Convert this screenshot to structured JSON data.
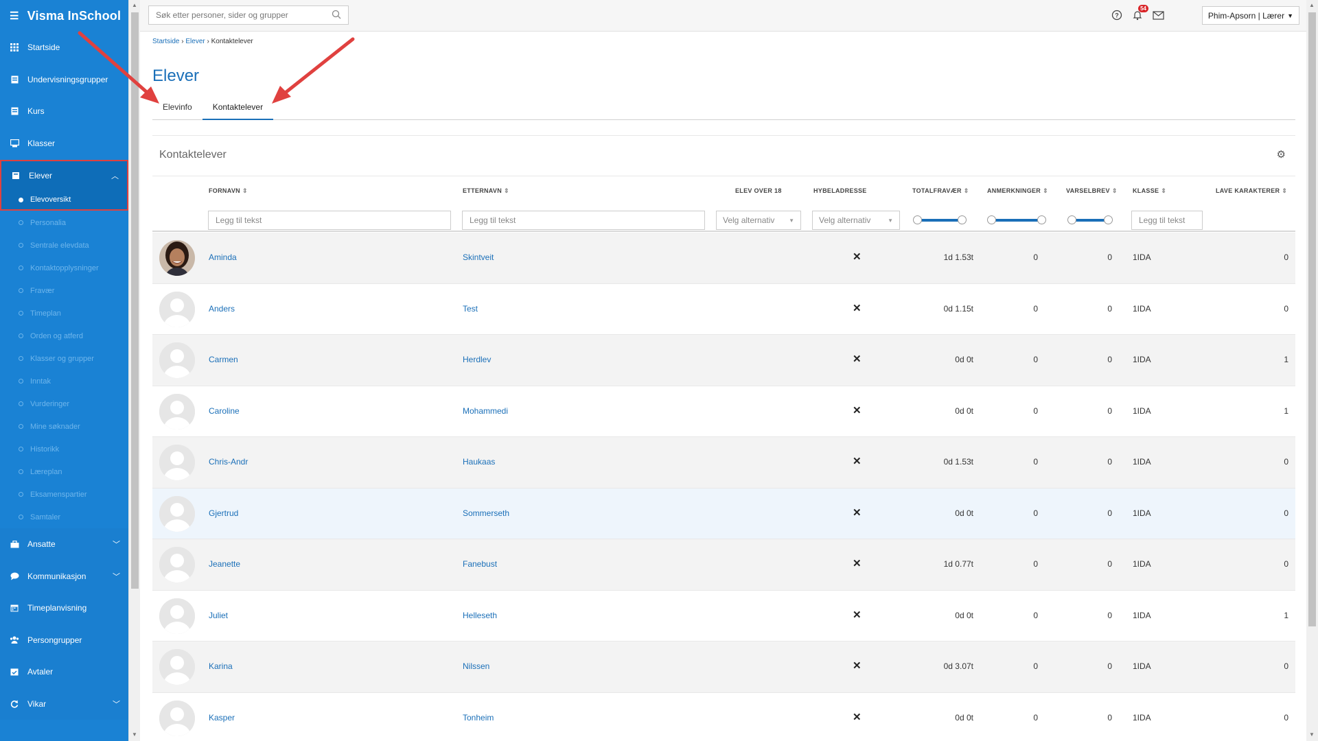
{
  "app": {
    "title": "Visma InSchool"
  },
  "sidebar": {
    "items_top": [
      {
        "label": "Startside",
        "icon": "grid-icon"
      },
      {
        "label": "Undervisningsgrupper",
        "icon": "book-icon"
      },
      {
        "label": "Kurs",
        "icon": "book-icon"
      },
      {
        "label": "Klasser",
        "icon": "board-icon"
      }
    ],
    "elever": {
      "label": "Elever",
      "active_sub": "Elevoversikt"
    },
    "subitems": [
      "Personalia",
      "Sentrale elevdata",
      "Kontaktopplysninger",
      "Fravær",
      "Timeplan",
      "Orden og atferd",
      "Klasser og grupper",
      "Inntak",
      "Vurderinger",
      "Mine søknader",
      "Historikk",
      "Læreplan",
      "Eksamenspartier",
      "Samtaler"
    ],
    "items_bottom": [
      {
        "label": "Ansatte",
        "icon": "briefcase-icon",
        "expandable": true
      },
      {
        "label": "Kommunikasjon",
        "icon": "chat-icon",
        "expandable": true
      },
      {
        "label": "Timeplanvisning",
        "icon": "calendar-icon",
        "expandable": false
      },
      {
        "label": "Persongrupper",
        "icon": "people-icon",
        "expandable": false
      },
      {
        "label": "Avtaler",
        "icon": "calendar-check-icon",
        "expandable": false
      },
      {
        "label": "Vikar",
        "icon": "refresh-icon",
        "expandable": true
      }
    ]
  },
  "topbar": {
    "search_placeholder": "Søk etter personer, sider og grupper",
    "notification_count": "54",
    "user_label": "Phim-Apsorn | Lærer"
  },
  "breadcrumb": {
    "items": [
      "Startside",
      "Elever"
    ],
    "current": "Kontaktelever"
  },
  "page": {
    "title": "Elever",
    "tabs": [
      "Elevinfo",
      "Kontaktelever"
    ],
    "active_tab": "Kontaktelever"
  },
  "card": {
    "title": "Kontaktelever",
    "columns": {
      "fornavn": "FORNAVN",
      "etternavn": "ETTERNAVN",
      "over18": "ELEV OVER 18",
      "hybel": "HYBELADRESSE",
      "fravaer": "TOTALFRAVÆR",
      "anm": "ANMERKNINGER",
      "varsel": "VARSELBREV",
      "klasse": "KLASSE",
      "lave": "LAVE KARAKTERER"
    },
    "filters": {
      "text_placeholder": "Legg til tekst",
      "select_placeholder": "Velg alternativ"
    }
  },
  "students": [
    {
      "fornavn": "Aminda",
      "etternavn": "Skintveit",
      "hybel": "✕",
      "fravaer": "1d 1.53t",
      "anm": "0",
      "varsel": "0",
      "klasse": "1IDA",
      "lave": "0",
      "photo": true
    },
    {
      "fornavn": "Anders",
      "etternavn": "Test",
      "hybel": "✕",
      "fravaer": "0d 1.15t",
      "anm": "0",
      "varsel": "0",
      "klasse": "1IDA",
      "lave": "0",
      "photo": false
    },
    {
      "fornavn": "Carmen",
      "etternavn": "Herdlev",
      "hybel": "✕",
      "fravaer": "0d 0t",
      "anm": "0",
      "varsel": "0",
      "klasse": "1IDA",
      "lave": "1",
      "photo": false
    },
    {
      "fornavn": "Caroline",
      "etternavn": "Mohammedi",
      "hybel": "✕",
      "fravaer": "0d 0t",
      "anm": "0",
      "varsel": "0",
      "klasse": "1IDA",
      "lave": "1",
      "photo": false
    },
    {
      "fornavn": "Chris-Andr",
      "etternavn": "Haukaas",
      "hybel": "✕",
      "fravaer": "0d 1.53t",
      "anm": "0",
      "varsel": "0",
      "klasse": "1IDA",
      "lave": "0",
      "photo": false
    },
    {
      "fornavn": "Gjertrud",
      "etternavn": "Sommerseth",
      "hybel": "✕",
      "fravaer": "0d 0t",
      "anm": "0",
      "varsel": "0",
      "klasse": "1IDA",
      "lave": "0",
      "photo": false
    },
    {
      "fornavn": "Jeanette",
      "etternavn": "Fanebust",
      "hybel": "✕",
      "fravaer": "1d 0.77t",
      "anm": "0",
      "varsel": "0",
      "klasse": "1IDA",
      "lave": "0",
      "photo": false
    },
    {
      "fornavn": "Juliet",
      "etternavn": "Helleseth",
      "hybel": "✕",
      "fravaer": "0d 0t",
      "anm": "0",
      "varsel": "0",
      "klasse": "1IDA",
      "lave": "1",
      "photo": false
    },
    {
      "fornavn": "Karina",
      "etternavn": "Nilssen",
      "hybel": "✕",
      "fravaer": "0d 3.07t",
      "anm": "0",
      "varsel": "0",
      "klasse": "1IDA",
      "lave": "0",
      "photo": false
    },
    {
      "fornavn": "Kasper",
      "etternavn": "Tonheim",
      "hybel": "✕",
      "fravaer": "0d 0t",
      "anm": "0",
      "varsel": "0",
      "klasse": "1IDA",
      "lave": "0",
      "photo": false
    }
  ],
  "colors": {
    "sidebar": "#1a82d4",
    "accent": "#1a6fb8",
    "highlight": "#e0413f"
  }
}
